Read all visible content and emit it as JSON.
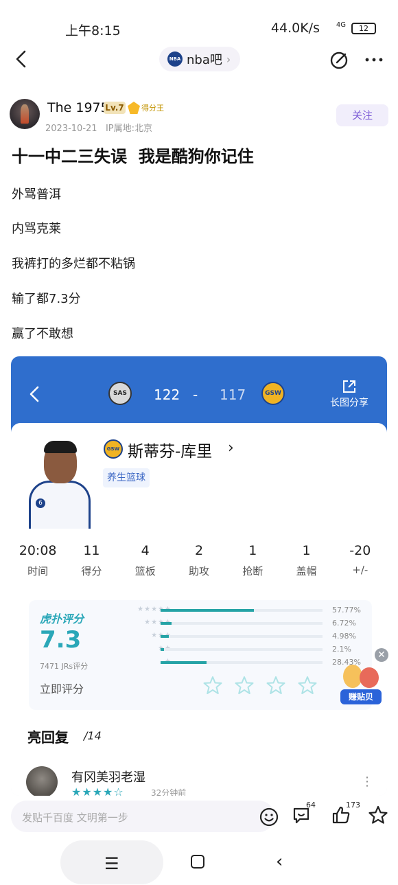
{
  "status_bar": {
    "time": "上午8:15",
    "network_speed": "44.0K/s",
    "signal": "4G",
    "battery": "12"
  },
  "top_bar": {
    "forum_name": "nba吧",
    "forum_logo": "NBA"
  },
  "author": {
    "name": "The 1975",
    "level": "Lv.7",
    "medal": "得分王",
    "date": "2023-10-21",
    "ip_location": "IP属地:北京",
    "follow_label": "关注"
  },
  "post": {
    "title": "十一中二三失误  我是酷狗你记住",
    "lines": [
      "外骂普洱",
      "内骂克莱",
      "我裤打的多烂都不粘锅",
      "输了都7.3分",
      "赢了不敢想"
    ]
  },
  "game_card": {
    "home_team": "SAS",
    "away_team": "GSW",
    "home_score": "122",
    "dash": "-",
    "away_score": "117",
    "share_label": "长图分享",
    "player": {
      "name": "斯蒂芬-库里",
      "team_logo": "GSW",
      "jersey": "6",
      "tag": "养生篮球"
    },
    "stats": [
      {
        "value": "20:08",
        "label": "时间"
      },
      {
        "value": "11",
        "label": "得分"
      },
      {
        "value": "4",
        "label": "篮板"
      },
      {
        "value": "2",
        "label": "助攻"
      },
      {
        "value": "1",
        "label": "抢断"
      },
      {
        "value": "1",
        "label": "盖帽"
      },
      {
        "value": "-20",
        "label": "+/-"
      }
    ],
    "rating": {
      "title": "虎扑评分",
      "score": "7.3",
      "count_text": "7471 JRs评分",
      "rate_now": "立即评分",
      "distribution": [
        {
          "stars": "★★★★★",
          "percent": "57.77%",
          "fraction": 0.5777
        },
        {
          "stars": "★★★★",
          "percent": "6.72%",
          "fraction": 0.0672
        },
        {
          "stars": "★★★",
          "percent": "4.98%",
          "fraction": 0.0498
        },
        {
          "stars": "★★",
          "percent": "2.1%",
          "fraction": 0.021
        },
        {
          "stars": "★",
          "percent": "28.43%",
          "fraction": 0.2843
        }
      ]
    },
    "replies": {
      "title": "亮回复",
      "count": "/14",
      "first": {
        "name": "有冈美羽老湿",
        "stars": "★★★★☆",
        "time": "32分钟前"
      }
    }
  },
  "promo": {
    "badge": "赚贴贝",
    "close": "✕"
  },
  "bottom_bar": {
    "input_placeholder": "发贴千百度 文明第一步",
    "comment_count": "64",
    "like_count": "173"
  },
  "nav_bar": {
    "menu": "☰",
    "back": "‹"
  }
}
